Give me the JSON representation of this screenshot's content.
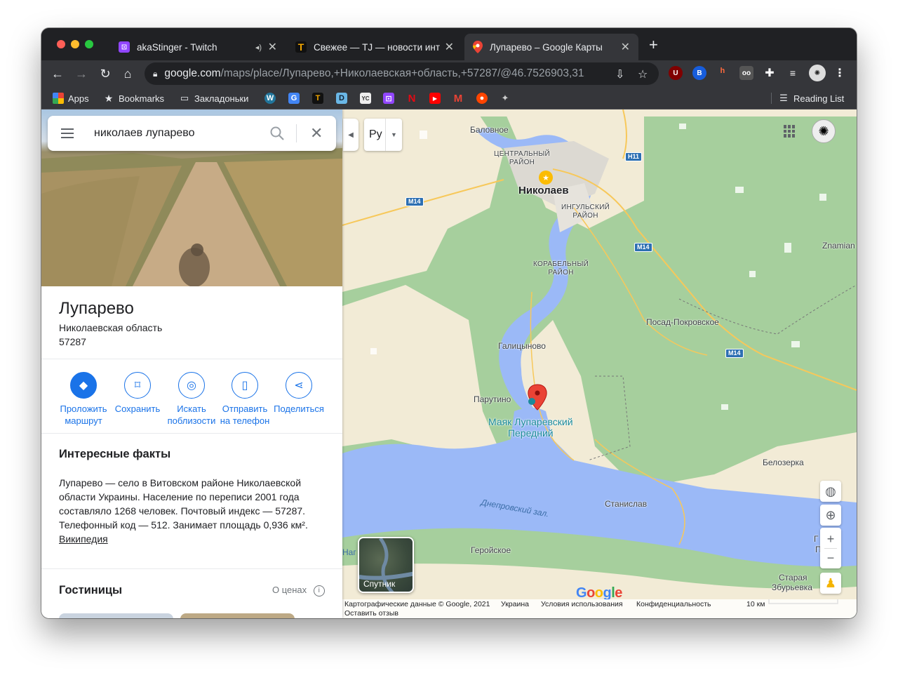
{
  "tabs": [
    {
      "title": "akaStinger - Twitch",
      "favicon": "twitch-icon",
      "color": "#9146ff",
      "audio": true
    },
    {
      "title": "Свежее — TJ — новости интернета",
      "favicon": "tj-icon",
      "color": "#f4a700"
    },
    {
      "title": "Лупарево – Google Карты",
      "favicon": "google-maps-icon",
      "color": "#ea4335",
      "active": true
    }
  ],
  "address": {
    "host": "google.com",
    "path": "/maps/place/Лупарево,+Николаевская+область,+57287/@46.7526903,31...."
  },
  "extensions": [
    {
      "name": "ublock-extension-icon",
      "badge": "1"
    },
    {
      "name": "bitwarden-extension-icon",
      "badge": "2"
    },
    {
      "name": "honey-extension-icon"
    },
    {
      "name": "glasses-extension-icon"
    },
    {
      "name": "puzzle-extension-icon"
    },
    {
      "name": "reading-queue-icon"
    },
    {
      "name": "profile-avatar"
    }
  ],
  "bookmarks": {
    "apps": "Apps",
    "bookmarks": "Bookmarks",
    "folder": "Закладоньки",
    "reading_list": "Reading List",
    "icons": [
      "wordpress-icon",
      "translate-icon",
      "tj-icon",
      "d-icon",
      "yc-icon",
      "twitch-icon",
      "netflix-icon",
      "youtube-icon",
      "gmail-icon",
      "reddit-icon",
      "game-icon"
    ]
  },
  "search": {
    "value": "николаев лупарево"
  },
  "place": {
    "name": "Лупарево",
    "region": "Николаевская область",
    "postcode": "57287"
  },
  "actions": [
    {
      "line1": "Проложить",
      "line2": "маршрут",
      "icon": "directions-icon"
    },
    {
      "line1": "Сохранить",
      "line2": "",
      "icon": "bookmark-icon"
    },
    {
      "line1": "Искать",
      "line2": "поблизости",
      "icon": "nearby-icon"
    },
    {
      "line1": "Отправить",
      "line2": "на телефон",
      "icon": "send-to-phone-icon"
    },
    {
      "line1": "Поделиться",
      "line2": "",
      "icon": "share-icon"
    }
  ],
  "facts": {
    "title": "Интересные факты",
    "text": "Лупарево — село в Витовском районе Николаевской области Украины. Население по переписи 2001 года составляло 1268 человек. Почтовый индекс — 57287. Телефонный код — 512. Занимает площадь 0,936 км². ",
    "link": "Википедия"
  },
  "hotels": {
    "title": "Гостиницы",
    "price_label": "О ценах"
  },
  "map": {
    "lang_button": "Ру",
    "labels": {
      "balovnoe": "Баловное",
      "central1": "ЦЕНТРАЛЬНЫЙ",
      "central2": "РАЙОН",
      "nikolaev": "Николаев",
      "ingul1": "ИНГУЛЬСКИЙ",
      "ingul2": "РАЙОН",
      "korab1": "КОРАБЕЛЬНЫЙ",
      "korab2": "РАЙОН",
      "znamian": "Znamian",
      "posad": "Посад-Покровское",
      "galitsinovo": "Галицыново",
      "parutino": "Парутино",
      "poi1": "Маяк Лупаревский",
      "poi2": "Передний",
      "belozerka": "Белозерка",
      "dnepr": "Днепровский зал.",
      "stanislav": "Станислав",
      "geroiskoe": "Геройское",
      "pri": "При",
      "staraya": "Старая",
      "zburievka": "Збурьевка",
      "nag": "Наг",
      "g": "Г"
    },
    "highways": {
      "h11": "Н11",
      "m14a": "М14",
      "m14b": "М14",
      "m14c": "М14"
    },
    "satellite": "Спутник",
    "footer": {
      "data": "Картографические данные © Google, 2021",
      "country": "Украина",
      "terms": "Условия использования",
      "privacy": "Конфиденциальность",
      "scale": "10 км",
      "feedback": "Оставить отзыв"
    }
  }
}
